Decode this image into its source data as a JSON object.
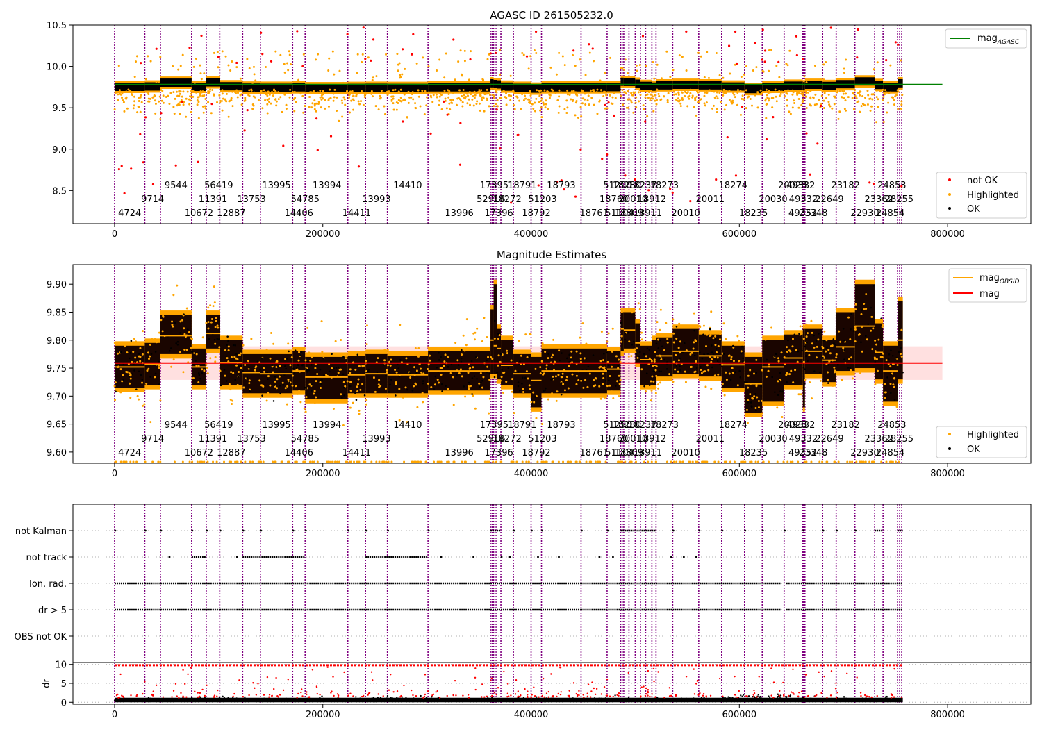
{
  "chart_data": [
    {
      "type": "scatter",
      "title": "AGASC ID 261505232.0",
      "xlabel": "",
      "ylabel": "",
      "xlim": [
        -40000,
        880000
      ],
      "ylim": [
        8.1,
        10.5
      ],
      "x_ticks": [
        0,
        200000,
        400000,
        600000,
        800000
      ],
      "x_tick_labels": [
        "0",
        "200000",
        "400000",
        "600000",
        "800000"
      ],
      "y_ticks": [
        8.5,
        9.0,
        9.5,
        10.0,
        10.5
      ],
      "y_tick_labels": [
        "8.5",
        "9.0",
        "9.5",
        "10.0",
        "10.5"
      ],
      "grid": false,
      "reference_line": {
        "label": "mag",
        "subscript": "AGASC",
        "y": 9.78,
        "x_range": [
          0,
          795000
        ],
        "color": "#008000"
      },
      "series": [
        {
          "name": "not OK",
          "color": "#ff0000"
        },
        {
          "name": "Highlighted",
          "color": "#ffa500"
        },
        {
          "name": "OK",
          "color": "#000000"
        }
      ],
      "data_band": {
        "x_range": [
          0,
          757000
        ],
        "baseline": 9.76
      },
      "legend_top": "upper right",
      "legend_bottom": "lower right"
    },
    {
      "type": "scatter",
      "title": "Magnitude Estimates",
      "xlabel": "",
      "ylabel": "",
      "xlim": [
        -40000,
        880000
      ],
      "ylim": [
        9.58,
        9.935
      ],
      "x_ticks": [
        0,
        200000,
        400000,
        600000,
        800000
      ],
      "x_tick_labels": [
        "0",
        "200000",
        "400000",
        "600000",
        "800000"
      ],
      "y_ticks": [
        9.6,
        9.65,
        9.7,
        9.75,
        9.8,
        9.85,
        9.9
      ],
      "y_tick_labels": [
        "9.60",
        "9.65",
        "9.70",
        "9.75",
        "9.80",
        "9.85",
        "9.90"
      ],
      "grid": false,
      "mean_line": {
        "label": "mag",
        "y": 9.759,
        "band": [
          9.729,
          9.789
        ],
        "x_range": [
          0,
          795000
        ],
        "color": "#ff0000"
      },
      "obsid_mean_label": {
        "label": "mag",
        "subscript": "OBSID",
        "color": "#ffa500"
      },
      "series": [
        {
          "name": "Highlighted",
          "color": "#ffa500"
        },
        {
          "name": "OK",
          "color": "#000000"
        }
      ],
      "segments": [
        {
          "x0": 0,
          "x1": 29000,
          "mean": 9.752,
          "low": 9.715,
          "high": 9.79
        },
        {
          "x0": 29000,
          "x1": 44000,
          "mean": 9.757,
          "low": 9.72,
          "high": 9.795
        },
        {
          "x0": 44000,
          "x1": 74000,
          "mean": 9.808,
          "low": 9.775,
          "high": 9.845
        },
        {
          "x0": 74000,
          "x1": 88000,
          "mean": 9.752,
          "low": 9.72,
          "high": 9.785
        },
        {
          "x0": 88000,
          "x1": 101000,
          "mean": 9.812,
          "low": 9.785,
          "high": 9.845
        },
        {
          "x0": 101000,
          "x1": 123000,
          "mean": 9.76,
          "low": 9.72,
          "high": 9.8
        },
        {
          "x0": 123000,
          "x1": 140000,
          "mean": 9.742,
          "low": 9.705,
          "high": 9.775
        },
        {
          "x0": 140000,
          "x1": 171000,
          "mean": 9.74,
          "low": 9.705,
          "high": 9.775
        },
        {
          "x0": 171000,
          "x1": 183000,
          "mean": 9.745,
          "low": 9.71,
          "high": 9.78
        },
        {
          "x0": 183000,
          "x1": 224000,
          "mean": 9.734,
          "low": 9.695,
          "high": 9.77
        },
        {
          "x0": 224000,
          "x1": 241000,
          "mean": 9.738,
          "low": 9.705,
          "high": 9.772
        },
        {
          "x0": 241000,
          "x1": 262000,
          "mean": 9.74,
          "low": 9.705,
          "high": 9.775
        },
        {
          "x0": 262000,
          "x1": 301000,
          "mean": 9.738,
          "low": 9.705,
          "high": 9.772
        },
        {
          "x0": 301000,
          "x1": 361000,
          "mean": 9.745,
          "low": 9.71,
          "high": 9.78
        },
        {
          "x0": 361000,
          "x1": 364000,
          "mean": 9.8,
          "low": 9.74,
          "high": 9.855
        },
        {
          "x0": 364000,
          "x1": 367000,
          "mean": 9.79,
          "low": 9.74,
          "high": 9.9
        },
        {
          "x0": 367000,
          "x1": 371000,
          "mean": 9.785,
          "low": 9.73,
          "high": 9.82
        },
        {
          "x0": 371000,
          "x1": 383000,
          "mean": 9.755,
          "low": 9.72,
          "high": 9.8
        },
        {
          "x0": 383000,
          "x1": 400000,
          "mean": 9.74,
          "low": 9.705,
          "high": 9.775
        },
        {
          "x0": 400000,
          "x1": 410000,
          "mean": 9.728,
          "low": 9.68,
          "high": 9.77
        },
        {
          "x0": 410000,
          "x1": 448000,
          "mean": 9.745,
          "low": 9.705,
          "high": 9.785
        },
        {
          "x0": 448000,
          "x1": 473000,
          "mean": 9.745,
          "low": 9.705,
          "high": 9.785
        },
        {
          "x0": 473000,
          "x1": 486000,
          "mean": 9.748,
          "low": 9.71,
          "high": 9.78
        },
        {
          "x0": 486000,
          "x1": 489000,
          "mean": 9.82,
          "low": 9.78,
          "high": 9.85
        },
        {
          "x0": 489000,
          "x1": 500000,
          "mean": 9.818,
          "low": 9.785,
          "high": 9.85
        },
        {
          "x0": 500000,
          "x1": 505000,
          "mean": 9.795,
          "low": 9.76,
          "high": 9.83
        },
        {
          "x0": 505000,
          "x1": 516000,
          "mean": 9.765,
          "low": 9.72,
          "high": 9.79
        },
        {
          "x0": 516000,
          "x1": 520000,
          "mean": 9.755,
          "low": 9.72,
          "high": 9.8
        },
        {
          "x0": 520000,
          "x1": 536000,
          "mean": 9.772,
          "low": 9.735,
          "high": 9.805
        },
        {
          "x0": 536000,
          "x1": 561000,
          "mean": 9.78,
          "low": 9.74,
          "high": 9.82
        },
        {
          "x0": 561000,
          "x1": 583000,
          "mean": 9.772,
          "low": 9.735,
          "high": 9.81
        },
        {
          "x0": 583000,
          "x1": 605000,
          "mean": 9.756,
          "low": 9.715,
          "high": 9.79
        },
        {
          "x0": 605000,
          "x1": 622000,
          "mean": 9.722,
          "low": 9.67,
          "high": 9.77
        },
        {
          "x0": 622000,
          "x1": 643000,
          "mean": 9.752,
          "low": 9.69,
          "high": 9.8
        },
        {
          "x0": 643000,
          "x1": 661000,
          "mean": 9.768,
          "low": 9.72,
          "high": 9.81
        },
        {
          "x0": 661000,
          "x1": 663000,
          "mean": 9.76,
          "low": 9.68,
          "high": 9.82
        },
        {
          "x0": 663000,
          "x1": 680000,
          "mean": 9.78,
          "low": 9.74,
          "high": 9.82
        },
        {
          "x0": 680000,
          "x1": 693000,
          "mean": 9.764,
          "low": 9.725,
          "high": 9.8
        },
        {
          "x0": 693000,
          "x1": 711000,
          "mean": 9.788,
          "low": 9.745,
          "high": 9.85
        },
        {
          "x0": 711000,
          "x1": 730000,
          "mean": 9.825,
          "low": 9.75,
          "high": 9.9
        },
        {
          "x0": 730000,
          "x1": 738000,
          "mean": 9.778,
          "low": 9.73,
          "high": 9.83
        },
        {
          "x0": 738000,
          "x1": 752000,
          "mean": 9.745,
          "low": 9.69,
          "high": 9.79
        },
        {
          "x0": 752000,
          "x1": 757000,
          "mean": 9.8,
          "low": 9.73,
          "high": 9.87
        }
      ],
      "legend_top": "upper right",
      "legend_bottom": "lower right"
    },
    {
      "type": "scatter",
      "title": "",
      "xlabel": "",
      "ylabel": "",
      "xlim": [
        -40000,
        880000
      ],
      "x_ticks": [
        0,
        200000,
        400000,
        600000,
        800000
      ],
      "x_tick_labels": [
        "0",
        "200000",
        "400000",
        "600000",
        "800000"
      ],
      "categories": [
        "not Kalman",
        "not track",
        "Ion. rad.",
        "dr > 5",
        "OBS not OK"
      ],
      "grid": true,
      "flag_rows": [
        {
          "category": "not Kalman",
          "ranges": [
            [
              0,
              2000
            ],
            [
              29000,
              31000
            ],
            [
              44000,
              46000
            ],
            [
              74000,
              76000
            ],
            [
              88000,
              90000
            ],
            [
              101000,
              103000
            ],
            [
              123000,
              125000
            ],
            [
              140000,
              142000
            ],
            [
              171000,
              173000
            ],
            [
              183000,
              185000
            ],
            [
              224000,
              226000
            ],
            [
              241000,
              243000
            ],
            [
              262000,
              264000
            ],
            [
              301000,
              303000
            ],
            [
              361000,
              371000
            ],
            [
              383000,
              385000
            ],
            [
              400000,
              402000
            ],
            [
              410000,
              412000
            ],
            [
              448000,
              450000
            ],
            [
              473000,
              475000
            ],
            [
              486000,
              520000
            ],
            [
              536000,
              538000
            ],
            [
              561000,
              563000
            ],
            [
              583000,
              585000
            ],
            [
              605000,
              607000
            ],
            [
              622000,
              624000
            ],
            [
              643000,
              645000
            ],
            [
              661000,
              663000
            ],
            [
              680000,
              682000
            ],
            [
              693000,
              695000
            ],
            [
              711000,
              713000
            ],
            [
              730000,
              738000
            ],
            [
              752000,
              757000
            ]
          ]
        },
        {
          "category": "not track",
          "ranges": [
            [
              52000,
              53000
            ],
            [
              74000,
              88000
            ],
            [
              117000,
              118000
            ],
            [
              123000,
              183000
            ],
            [
              241000,
              301000
            ],
            [
              313000,
              314000
            ],
            [
              344000,
              345000
            ],
            [
              371000,
              372000
            ],
            [
              379000,
              380000
            ],
            [
              406000,
              407000
            ],
            [
              426000,
              427000
            ],
            [
              465000,
              466000
            ],
            [
              478000,
              479000
            ],
            [
              534000,
              535000
            ],
            [
              546000,
              547000
            ],
            [
              558000,
              559000
            ]
          ]
        },
        {
          "category": "Ion. rad.",
          "ranges": [
            [
              0,
              29000
            ],
            [
              29000,
              44000
            ],
            [
              44000,
              74000
            ],
            [
              74000,
              101000
            ],
            [
              101000,
              183000
            ],
            [
              183000,
              301000
            ],
            [
              301000,
              361000
            ],
            [
              361000,
              448000
            ],
            [
              448000,
              640000
            ],
            [
              645000,
              757000
            ]
          ]
        },
        {
          "category": "dr > 5",
          "ranges": [
            [
              0,
              29000
            ],
            [
              29000,
              44000
            ],
            [
              44000,
              74000
            ],
            [
              74000,
              101000
            ],
            [
              101000,
              183000
            ],
            [
              183000,
              301000
            ],
            [
              301000,
              361000
            ],
            [
              361000,
              448000
            ],
            [
              448000,
              640000
            ],
            [
              645000,
              757000
            ]
          ]
        },
        {
          "category": "OBS not OK",
          "ranges": []
        }
      ]
    },
    {
      "type": "scatter",
      "title": "",
      "xlabel": "",
      "ylabel": "dr",
      "xlim": [
        -40000,
        880000
      ],
      "ylim": [
        -0.5,
        10.5
      ],
      "y_ticks": [
        0,
        5,
        10
      ],
      "y_tick_labels": [
        "0",
        "5",
        "10"
      ],
      "grid": true,
      "series": [
        {
          "name": "",
          "color": "#ff0000"
        },
        {
          "name": "",
          "color": "#000000"
        }
      ]
    }
  ],
  "obsid_boundaries": [
    0,
    29000,
    44000,
    74000,
    88000,
    101000,
    123000,
    140000,
    171000,
    183000,
    224000,
    241000,
    262000,
    301000,
    361000,
    362500,
    364000,
    365500,
    367000,
    371000,
    383000,
    400000,
    410000,
    448000,
    473000,
    486000,
    487500,
    489000,
    494000,
    500000,
    505000,
    510000,
    516000,
    520000,
    536000,
    561000,
    583000,
    605000,
    622000,
    643000,
    661000,
    662000,
    663000,
    680000,
    693000,
    711000,
    730000,
    738000,
    752000,
    754000,
    756000
  ],
  "obsid_labels": [
    {
      "text": "4724",
      "x": 14500,
      "row": 0
    },
    {
      "text": "9714",
      "x": 36500,
      "row": 1
    },
    {
      "text": "9544",
      "x": 59000,
      "row": 2
    },
    {
      "text": "10672",
      "x": 81000,
      "row": 0
    },
    {
      "text": "11391",
      "x": 94500,
      "row": 1
    },
    {
      "text": "56419",
      "x": 100000,
      "row": 2
    },
    {
      "text": "12887",
      "x": 112000,
      "row": 0
    },
    {
      "text": "13753",
      "x": 131500,
      "row": 1
    },
    {
      "text": "13995",
      "x": 155500,
      "row": 2
    },
    {
      "text": "14406",
      "x": 177000,
      "row": 0
    },
    {
      "text": "54785",
      "x": 183000,
      "row": 1
    },
    {
      "text": "13994",
      "x": 204000,
      "row": 2
    },
    {
      "text": "14411",
      "x": 232500,
      "row": 0
    },
    {
      "text": "13993",
      "x": 251500,
      "row": 1
    },
    {
      "text": "14410",
      "x": 281500,
      "row": 2
    },
    {
      "text": "13996",
      "x": 331000,
      "row": 0
    },
    {
      "text": "52916",
      "x": 361500,
      "row": 1
    },
    {
      "text": "17395",
      "x": 364500,
      "row": 2
    },
    {
      "text": "17396",
      "x": 369000,
      "row": 0
    },
    {
      "text": "18272",
      "x": 377000,
      "row": 1
    },
    {
      "text": "18791",
      "x": 391500,
      "row": 2
    },
    {
      "text": "18792",
      "x": 405000,
      "row": 0
    },
    {
      "text": "51203",
      "x": 411000,
      "row": 1
    },
    {
      "text": "18793",
      "x": 429000,
      "row": 2
    },
    {
      "text": "18761",
      "x": 460500,
      "row": 0
    },
    {
      "text": "18760",
      "x": 479500,
      "row": 1
    },
    {
      "text": "51290",
      "x": 483000,
      "row": 2
    },
    {
      "text": "51104",
      "x": 485000,
      "row": 0
    },
    {
      "text": "18280",
      "x": 492000,
      "row": 2
    },
    {
      "text": "18809",
      "x": 494000,
      "row": 0
    },
    {
      "text": "20010",
      "x": 498000,
      "row": 1
    },
    {
      "text": "18237",
      "x": 507000,
      "row": 2
    },
    {
      "text": "18911",
      "x": 512000,
      "row": 0
    },
    {
      "text": "18912",
      "x": 516000,
      "row": 1
    },
    {
      "text": "18273",
      "x": 528000,
      "row": 2
    },
    {
      "text": "20010",
      "x": 548500,
      "row": 0
    },
    {
      "text": "20011",
      "x": 572000,
      "row": 1
    },
    {
      "text": "18274",
      "x": 594000,
      "row": 2
    },
    {
      "text": "18235",
      "x": 613500,
      "row": 0
    },
    {
      "text": "20030",
      "x": 632500,
      "row": 1
    },
    {
      "text": "20028",
      "x": 651000,
      "row": 2
    },
    {
      "text": "49332",
      "x": 661500,
      "row": 1
    },
    {
      "text": "49352",
      "x": 661000,
      "row": 0
    },
    {
      "text": "23348",
      "x": 671000,
      "row": 0
    },
    {
      "text": "49332",
      "x": 659000,
      "row": 2
    },
    {
      "text": "22649",
      "x": 686500,
      "row": 1
    },
    {
      "text": "23182",
      "x": 702000,
      "row": 2
    },
    {
      "text": "22930",
      "x": 720500,
      "row": 0
    },
    {
      "text": "23362",
      "x": 734000,
      "row": 1
    },
    {
      "text": "24854",
      "x": 745000,
      "row": 0
    },
    {
      "text": "28255",
      "x": 753500,
      "row": 1
    },
    {
      "text": "24853",
      "x": 746500,
      "row": 2
    }
  ]
}
